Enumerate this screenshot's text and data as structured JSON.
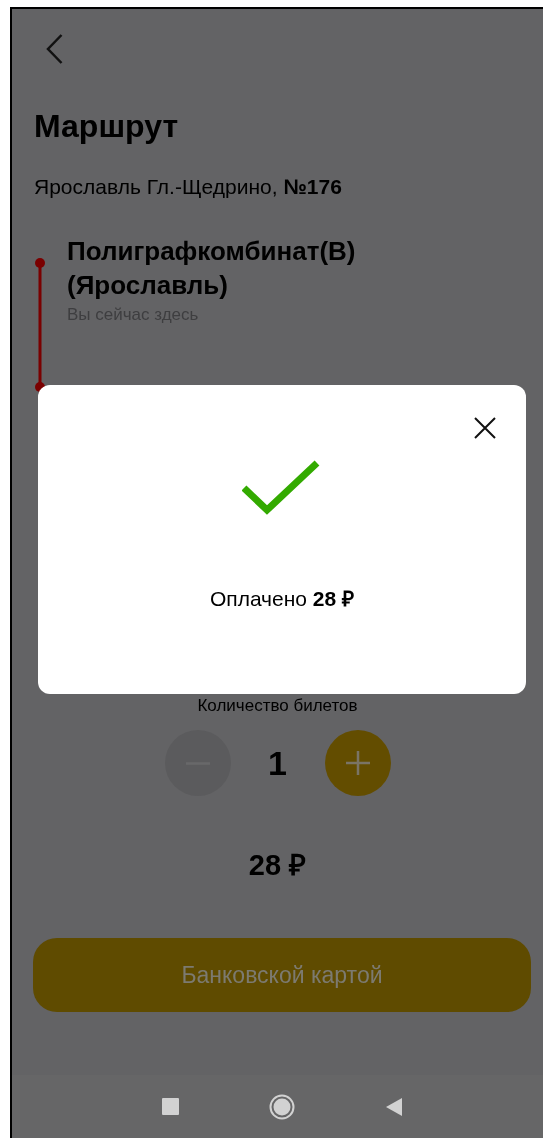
{
  "header": {
    "title": "Маршрут",
    "route": "Ярославль Гл.-Щедрино, **№176**"
  },
  "stops": [
    {
      "name": "Полиграфкомбинат(В) (Ярославль)",
      "note": "Вы сейчас здесь"
    }
  ],
  "tickets": {
    "label": "Количество билетов",
    "count": "1",
    "decrease": {
      "disabled": true
    },
    "increase": {
      "disabled": false
    }
  },
  "total": "28 ₽",
  "pay_button": {
    "label": "Банковской картой"
  },
  "dialog": {
    "message": "Оплачено **28 ₽**"
  }
}
